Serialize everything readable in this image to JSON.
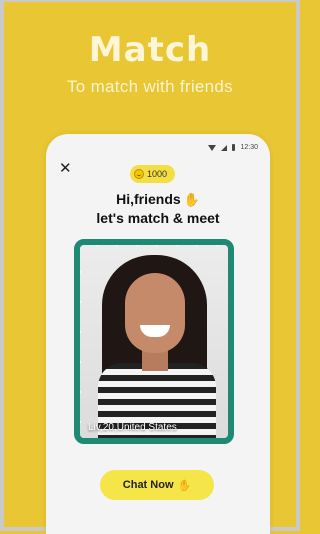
{
  "hero": {
    "title": "Match",
    "subtitle": "To match with friends"
  },
  "status_bar": {
    "time": "12:30"
  },
  "header": {
    "close_icon": "close-icon",
    "coins": "1000"
  },
  "greeting": {
    "line1": "Hi,friends",
    "line2": "let's match & meet"
  },
  "profile": {
    "caption": "Liv,20,United States"
  },
  "cta": {
    "label": "Chat Now"
  },
  "colors": {
    "background": "#e8c634",
    "accent_green": "#1e8a74",
    "button_yellow": "#f6e548"
  }
}
